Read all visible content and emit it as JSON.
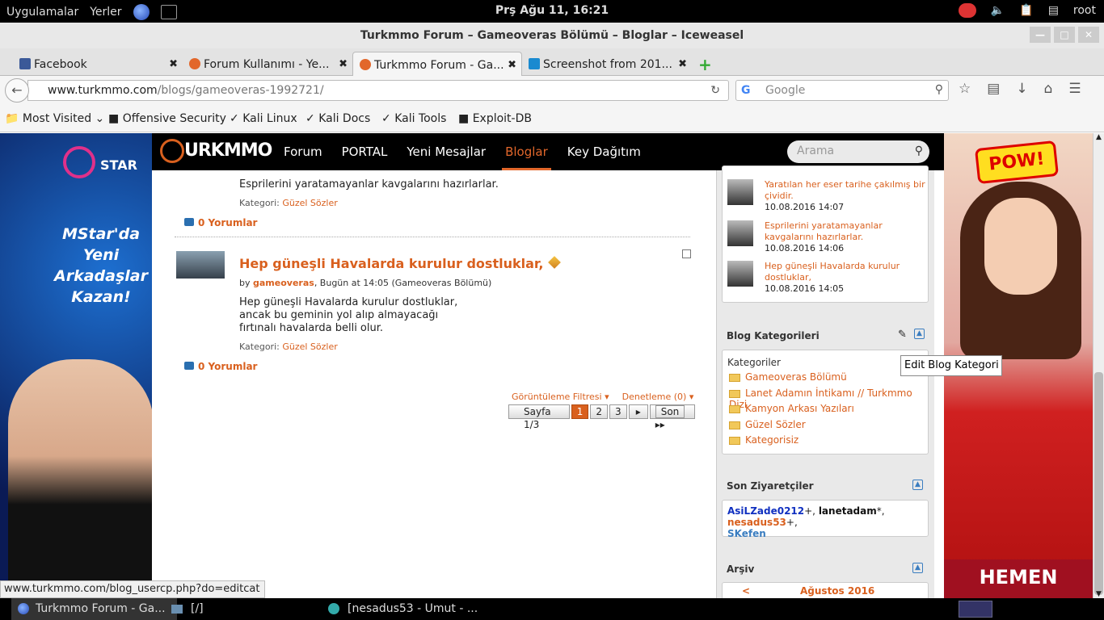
{
  "system": {
    "apps": "Uygulamalar",
    "places": "Yerler",
    "clock": "Prş Ağu 11, 16:21",
    "user": "root"
  },
  "window": {
    "title": "Turkmmo Forum – Gameoveras Bölümü – Bloglar – Iceweasel"
  },
  "tabs": [
    "Facebook",
    "Forum Kullanımı - Ye...",
    "Turkmmo Forum - Ga...",
    "Screenshot from 201..."
  ],
  "nav": {
    "url_host": "www.turkmmo.com",
    "url_path": "/blogs/gameoveras-1992721/",
    "search_placeholder": "Google"
  },
  "bookmarks": [
    "Most Visited",
    "Offensive Security",
    "Kali Linux",
    "Kali Docs",
    "Kali Tools",
    "Exploit-DB"
  ],
  "ads": {
    "left_brand": "STAR",
    "left_text": "MStar'da Yeni Arkadaşlar Kazan!",
    "right_top": "POW!",
    "right_bottom": "HEMEN"
  },
  "site": {
    "logo": "URKMMO",
    "menu": [
      "Forum",
      "PORTAL",
      "Yeni Mesajlar",
      "Bloglar",
      "Key Dağıtım"
    ],
    "search_placeholder": "Arama"
  },
  "posts": {
    "prev_text": "Esprilerini yaratamayanlar kavgalarını hazırlarlar.",
    "prev_cat_label": "Kategori:",
    "prev_cat": "Güzel Sözler",
    "prev_comments": "0 Yorumlar",
    "title": "Hep güneşli Havalarda kurulur dostluklar,",
    "by": "by",
    "author": "gameoveras",
    "meta": ", Bugün at 14:05 (Gameoveras Bölümü)",
    "line1": "Hep güneşli Havalarda kurulur dostluklar,",
    "line2": "ancak bu geminin yol alıp almayacağı",
    "line3": "fırtınalı havalarda belli olur.",
    "cat_label": "Kategori:",
    "cat": "Güzel Sözler",
    "comments": "0 Yorumlar"
  },
  "pagination": {
    "view_filter": "Görüntüleme Filtresi",
    "moderation": "Denetleme (0)",
    "page_label": "Sayfa 1/3",
    "pages": [
      "1",
      "2",
      "3"
    ],
    "last": "Son"
  },
  "sidebar": {
    "recent": [
      {
        "title": "Yaratılan her eser tarihe çakılmış bir çividir.",
        "date": "10.08.2016 14:07"
      },
      {
        "title": "Esprilerini yaratamayanlar kavgalarını hazırlarlar.",
        "date": "10.08.2016 14:06"
      },
      {
        "title": "Hep güneşli Havalarda kurulur dostluklar,",
        "date": "10.08.2016 14:05"
      }
    ],
    "categories_title": "Blog Kategorileri",
    "categories_label": "Kategoriler",
    "categories": [
      "Gameoveras Bölümü",
      "Lanet Adamın İntikamı // Turkmmo Dizi",
      "Kamyon Arkası Yazıları",
      "Güzel Sözler",
      "Kategorisiz"
    ],
    "tooltip": "Edit Blog Kategori",
    "visitors_title": "Son Ziyaretçiler",
    "visitors": [
      "AsiLZade0212",
      "lanetadam",
      "nesadus53",
      "SKefen"
    ],
    "archive_title": "Arşiv",
    "archive_month": "Ağustos 2016"
  },
  "status_url": "www.turkmmo.com/blog_usercp.php?do=editcat",
  "taskbar": [
    "Turkmmo Forum - Ga...",
    "[/]",
    "[nesadus53 - Umut - ..."
  ]
}
